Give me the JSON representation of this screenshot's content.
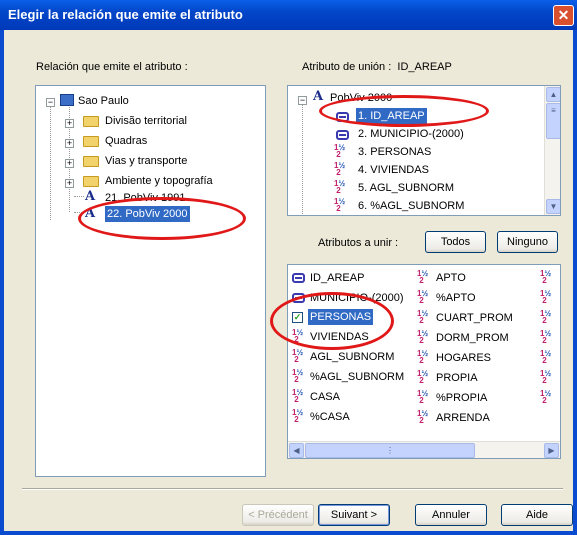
{
  "window": {
    "title": "Elegir la relación que emite el atributo",
    "close_glyph": "✕"
  },
  "left": {
    "label": "Relación que emite el atributo :",
    "tree": {
      "root": "Sao Paulo",
      "folders": [
        "Divisão territorial",
        "Quadras",
        "Vias y transporte",
        "Ambiente y topografía"
      ],
      "relations": [
        "21. PobViv 1991",
        "22. PobViv 2000"
      ],
      "selected": "22. PobViv 2000"
    }
  },
  "right": {
    "join_label": "Atributo de unión :",
    "join_value": "ID_AREAP",
    "attr_tree": {
      "root": "PobViv 2000",
      "items": [
        {
          "label": "1. ID_AREAP",
          "icon": "id-key-icon"
        },
        {
          "label": "2. MUNICIPIO-(2000)",
          "icon": "id-key-icon"
        },
        {
          "label": "3. PERSONAS",
          "icon": "numeric-icon"
        },
        {
          "label": "4. VIVIENDAS",
          "icon": "numeric-icon"
        },
        {
          "label": "5. AGL_SUBNORM",
          "icon": "numeric-icon"
        },
        {
          "label": "6. %AGL_SUBNORM",
          "icon": "numeric-icon"
        }
      ]
    },
    "attrs_label": "Atributos a unir :",
    "btn_all": "Todos",
    "btn_none": "Ninguno",
    "grid": {
      "col1": [
        "ID_AREAP",
        "MUNICIPIO-(2000)",
        "PERSONAS",
        "VIVIENDAS",
        "AGL_SUBNORM",
        "%AGL_SUBNORM",
        "CASA",
        "%CASA"
      ],
      "col2": [
        "APTO",
        "%APTO",
        "CUART_PROM",
        "DORM_PROM",
        "HOGARES",
        "PROPIA",
        "%PROPIA",
        "ARRENDA"
      ],
      "checked": "PERSONAS"
    }
  },
  "footer": {
    "back": "< Précédent",
    "next": "Suivant >",
    "cancel": "Annuler",
    "help": "Aide"
  },
  "colors": {
    "selection": "#316AC5",
    "annotation": "#E01818",
    "title_bar": "#0A5FE8"
  }
}
